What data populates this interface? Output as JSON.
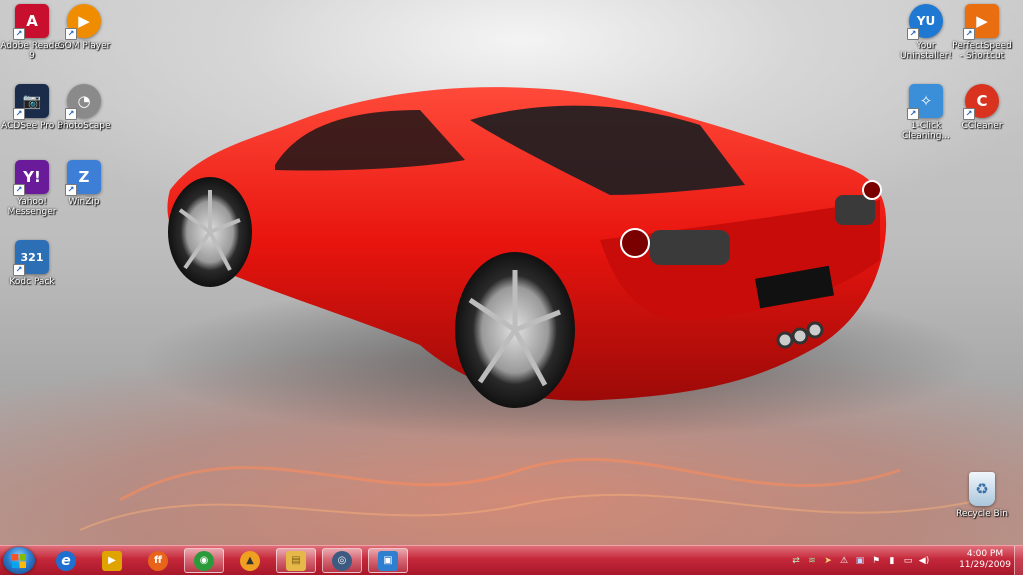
{
  "desktop": {
    "icons_left": [
      {
        "label": "Adobe Reader 9",
        "icon": "adobe-reader-icon",
        "text": "A",
        "color": "#c8102e"
      },
      {
        "label": "GOM Player",
        "icon": "gom-player-icon",
        "text": "▶",
        "color": "#f08c00"
      },
      {
        "label": "ACDSee Pro 3",
        "icon": "acdsee-icon",
        "text": "📷",
        "color": "#1b2c4a"
      },
      {
        "label": "PhotoScape",
        "icon": "photoscape-icon",
        "text": "◔",
        "color": "#8a8a8a"
      },
      {
        "label": "Yahoo! Messenger",
        "icon": "yahoo-messenger-icon",
        "text": "Y!",
        "color": "#6a1b9a"
      },
      {
        "label": "WinZip",
        "icon": "winzip-icon",
        "text": "Z",
        "color": "#3d7fd6"
      },
      {
        "label": "Kodc Pack",
        "icon": "codec-pack-icon",
        "text": "321",
        "color": "#2d6fb5"
      }
    ],
    "icons_right": [
      {
        "label": "Your Uninstaller!",
        "icon": "uninstaller-icon",
        "text": "YU",
        "color": "#1f78d1"
      },
      {
        "label": "PerfectSpeed - Shortcut",
        "icon": "perfectspeed-icon",
        "text": "▶",
        "color": "#e86e10"
      },
      {
        "label": "1-Click Cleaning...",
        "icon": "cleaning-icon",
        "text": "✧",
        "color": "#3a8fd8"
      },
      {
        "label": "CCleaner",
        "icon": "ccleaner-icon",
        "text": "C",
        "color": "#d9321f"
      }
    ],
    "recycle_bin": {
      "label": "Recycle Bin",
      "icon": "recycle-bin-icon"
    }
  },
  "taskbar": {
    "start_icon": "windows-logo-icon",
    "items": [
      {
        "name": "internet-explorer",
        "icon": "internet-explorer-icon",
        "text": "e",
        "color": "#1e6fd0",
        "open": false
      },
      {
        "name": "media-player",
        "icon": "media-player-icon",
        "text": "▶",
        "color": "#e0a400",
        "open": false
      },
      {
        "name": "firefox",
        "icon": "firefox-icon",
        "text": "ff",
        "color": "#e8641a",
        "open": false
      },
      {
        "name": "network-app",
        "icon": "globe-icon",
        "text": "◉",
        "color": "#2a9a3a",
        "open": true
      },
      {
        "name": "aimp",
        "icon": "aimp-icon",
        "text": "▲",
        "color": "#f0a020",
        "open": false
      },
      {
        "name": "windows-explorer",
        "icon": "folder-icon",
        "text": "▤",
        "color": "#e6b84a",
        "open": true
      },
      {
        "name": "screen-capture",
        "icon": "camera-icon",
        "text": "◎",
        "color": "#3d5a80",
        "open": true
      },
      {
        "name": "remote-desktop",
        "icon": "monitor-icon",
        "text": "▣",
        "color": "#2f7fd0",
        "open": true
      }
    ],
    "tray": [
      "network-tray-icon",
      "app-tray-icon",
      "arrow-tray-icon",
      "adobe-tray-icon",
      "monitor-tray-icon",
      "flag-tray-icon",
      "power-tray-icon",
      "display-tray-icon",
      "volume-tray-icon"
    ],
    "clock": {
      "time": "4:00 PM",
      "date": "11/29/2009"
    }
  }
}
